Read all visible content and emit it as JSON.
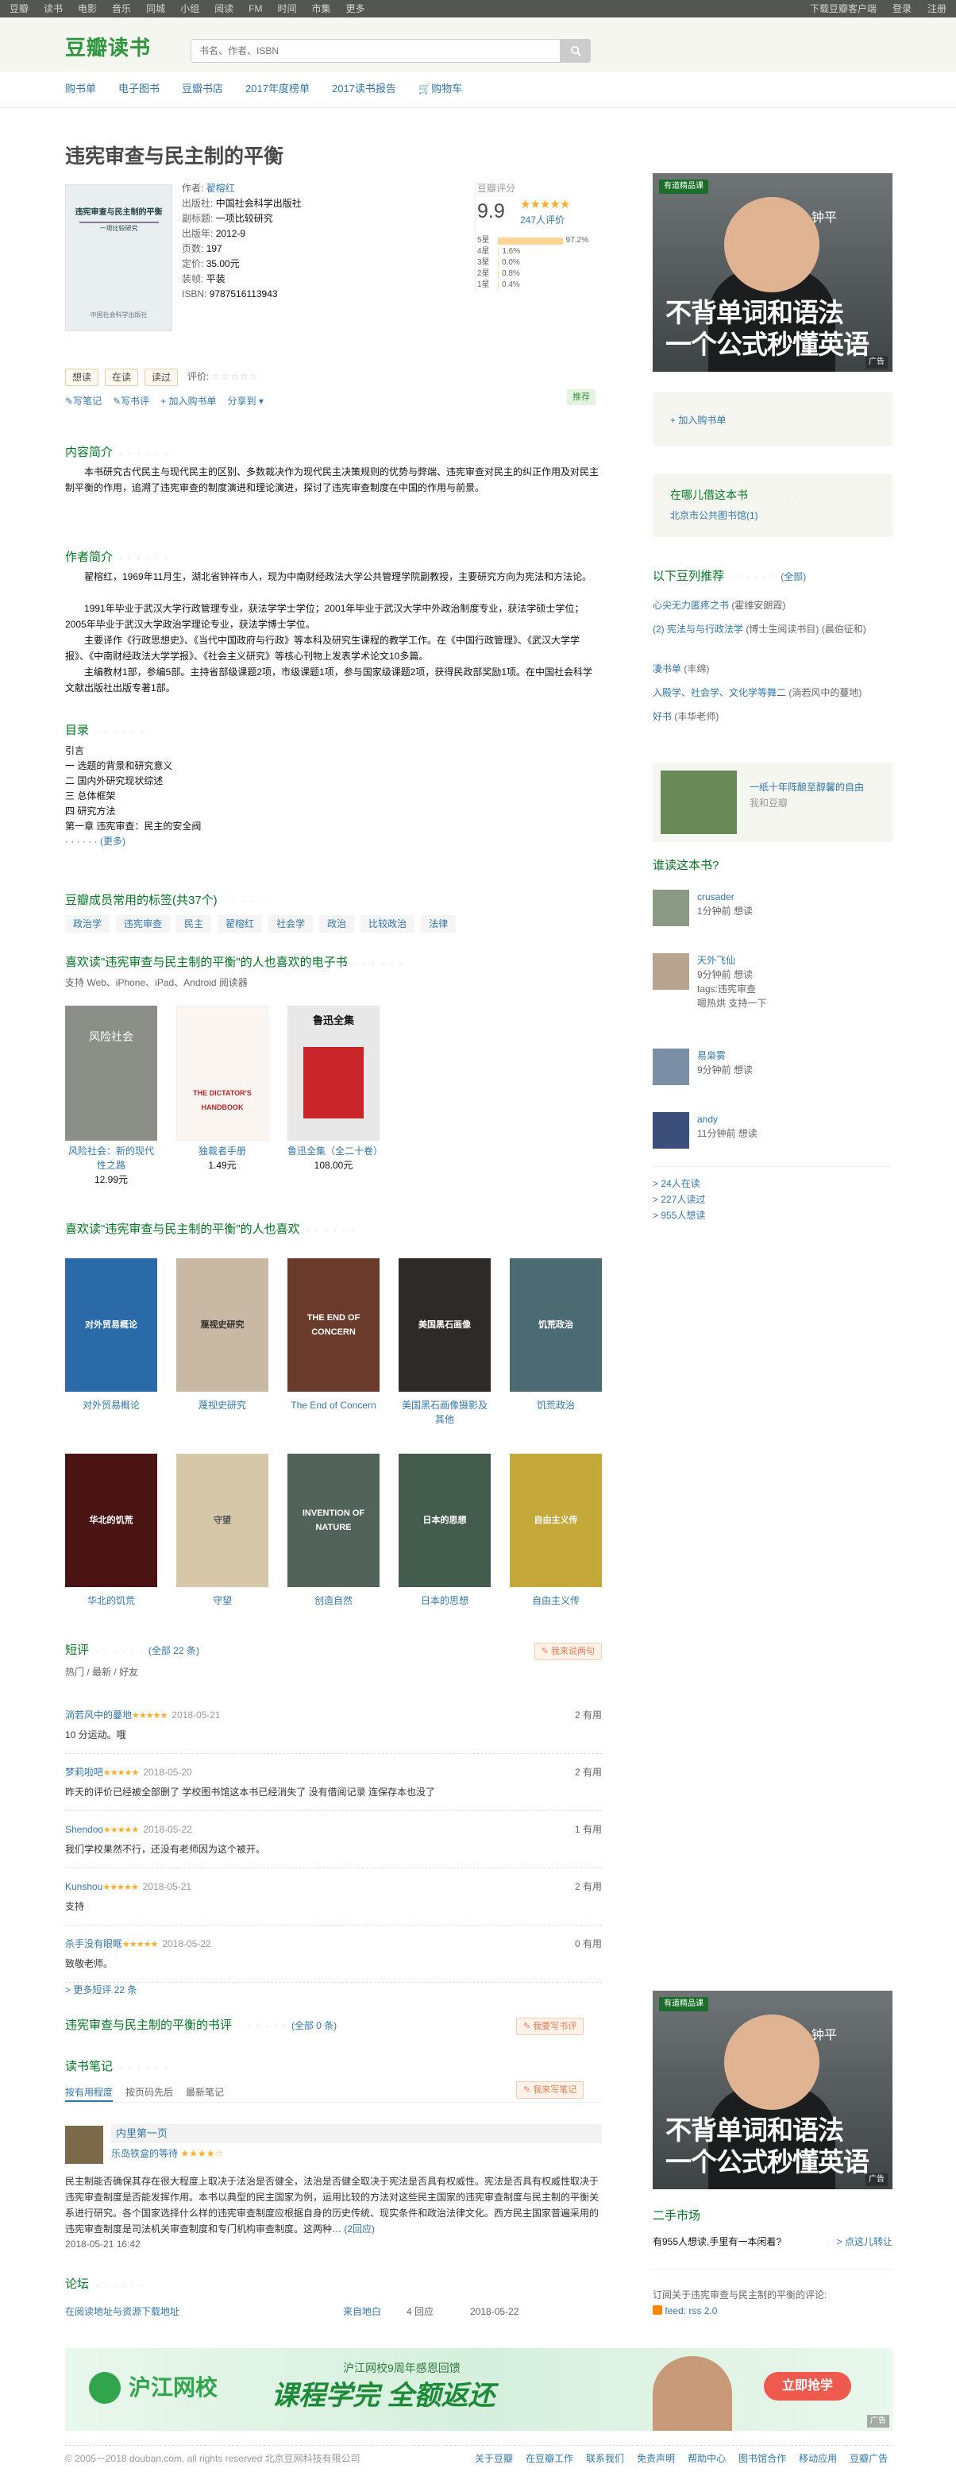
{
  "topbar": {
    "nav": [
      "豆瓣",
      "读书",
      "电影",
      "音乐",
      "同城",
      "小组",
      "阅读",
      "FM",
      "时间",
      "市集",
      "更多"
    ],
    "right": [
      "下载豆瓣客户端",
      "登录",
      "注册"
    ]
  },
  "header": {
    "logo": "豆瓣读书",
    "search_placeholder": "书名、作者、ISBN"
  },
  "subnav": [
    "购书单",
    "电子图书",
    "豆瓣书店",
    "2017年度榜单",
    "2017读书报告",
    "购物车"
  ],
  "book": {
    "title": "违宪审查与民主制的平衡",
    "cover_title": "违宪审查与民主制的平衡",
    "cover_sub": "一项比较研究",
    "cover_pub": "中国社会科学出版社",
    "info": [
      {
        "k": "作者:",
        "v": "翟榕红",
        "link": true
      },
      {
        "k": "出版社:",
        "v": "中国社会科学出版社"
      },
      {
        "k": "副标题:",
        "v": "一项比较研究"
      },
      {
        "k": "出版年:",
        "v": "2012-9"
      },
      {
        "k": "页数:",
        "v": "197"
      },
      {
        "k": "定价:",
        "v": "35.00元"
      },
      {
        "k": "装帧:",
        "v": "平装"
      },
      {
        "k": "ISBN:",
        "v": "9787516113943"
      }
    ]
  },
  "rating": {
    "label": "豆瓣评分",
    "score": "9.9",
    "stars": "★★★★★",
    "count": "247人评价",
    "dist": [
      {
        "s": "5星",
        "p": "97.2%",
        "f": 0.972
      },
      {
        "s": "4星",
        "p": "1.6%",
        "f": 0.016
      },
      {
        "s": "3星",
        "p": "0.0%",
        "f": 0
      },
      {
        "s": "2星",
        "p": "0.8%",
        "f": 0.008
      },
      {
        "s": "1星",
        "p": "0.4%",
        "f": 0.004
      }
    ]
  },
  "actions": {
    "want": "想读",
    "reading": "在读",
    "read": "读过",
    "rate_label": "评价:",
    "rate_stars": "☆☆☆☆☆",
    "links": [
      "写笔记",
      "写书评",
      "加入购书单",
      "分享到"
    ],
    "recommend": "推荐"
  },
  "intro": {
    "title": "内容简介",
    "text": "本书研究古代民主与现代民主的区别、多数裁决作为现代民主决策规则的优势与弊端、违宪审查对民主的纠正作用及对民主制平衡的作用，追溯了违宪审查的制度演进和理论演进，探讨了违宪审查制度在中国的作用与前景。"
  },
  "author": {
    "title": "作者简介",
    "p1": "翟榕红，1969年11月生，湖北省钟祥市人，现为中南财经政法大学公共管理学院副教授，主要研究方向为宪法和方法论。",
    "p2": "1991年毕业于武汉大学行政管理专业，获法学学士学位；2001年毕业于武汉大学中外政治制度专业，获法学硕士学位；2005年毕业于武汉大学政治学理论专业，获法学博士学位。",
    "p3": "主要译作《行政思想史》、《当代中国政府与行政》等本科及研究生课程的教学工作。在《中国行政管理》、《武汉大学学报》、《中南财经政法大学学报》、《社会主义研究》等核心刊物上发表学术论文10多篇。",
    "p4": "主编教材1部，参编5部。主持省部级课题2项，市级课题1项，参与国家级课题2项，获得民政部奖励1项。在中国社会科学文献出版社出版专著1部。"
  },
  "toc": {
    "title": "目录",
    "items": [
      "引言",
      "一 选题的背景和研究意义",
      "二 国内外研究现状综述",
      "三 总体框架",
      "四 研究方法",
      "第一章 违宪审查：民主的安全阀"
    ],
    "more": "· · · · · · (更多)"
  },
  "tags": {
    "title": "豆瓣成员常用的标签(共37个)",
    "items": [
      "政治学",
      "违宪审查",
      "民主",
      "翟榕红",
      "社会学",
      "政治",
      "比较政治",
      "法律"
    ]
  },
  "ebooks": {
    "title": "喜欢读\"违宪审查与民主制的平衡\"的人也喜欢的电子书",
    "support": "支持 Web、iPhone、iPad、Android 阅读器",
    "items": [
      {
        "name": "风险社会：新的现代性之路",
        "price": "12.99元",
        "cover": "风险社会"
      },
      {
        "name": "独裁者手册",
        "price": "1.49元",
        "cover": "THE DICTATOR'S HANDBOOK"
      },
      {
        "name": "鲁迅全集（全二十卷）",
        "price": "108.00元",
        "cover": "鲁迅全集"
      }
    ]
  },
  "alsolike": {
    "title": "喜欢读\"违宪审查与民主制的平衡\"的人也喜欢",
    "row1": [
      {
        "name": "对外贸易概论",
        "cover": "对外贸易概论",
        "c": "#2a6aa8"
      },
      {
        "name": "蔑视史研究",
        "cover": "蔑视史研究",
        "c": "#c9b8a4"
      },
      {
        "name": "The End of Concern",
        "cover": "THE END OF CONCERN",
        "c": "#6a3a2a"
      },
      {
        "name": "美国黑石画像摄影及其他",
        "cover": "美国黑石画像",
        "c": "#2d2a28"
      },
      {
        "name": "饥荒政治",
        "cover": "饥荒政治",
        "c": "#4c6a72"
      }
    ],
    "row2": [
      {
        "name": "华北的饥荒",
        "cover": "华北的饥荒",
        "c": "#4a1412"
      },
      {
        "name": "守望",
        "cover": "守望",
        "c": "#d6c7a8"
      },
      {
        "name": "创造自然",
        "cover": "INVENTION OF NATURE",
        "c": "#52635a"
      },
      {
        "name": "日本的思想",
        "cover": "日本的思想",
        "c": "#445c4e"
      },
      {
        "name": "自由主义传",
        "cover": "自由主义传",
        "c": "#c4a83a"
      }
    ]
  },
  "comments": {
    "title": "短评",
    "count": "(全部 22 条)",
    "write": "我来说两句",
    "sort": "热门 / 最新 / 好友",
    "items": [
      {
        "u": "淌若风中的蔓地",
        "st": "★★★★★",
        "t": "2018-05-21",
        "use": "2 有用",
        "txt": "10 分运动。哦"
      },
      {
        "u": "梦莉啦吧",
        "st": "★★★★★",
        "t": "2018-05-20",
        "use": "2 有用",
        "txt": "昨天的评价已经被全部删了 学校图书馆这本书已经消失了 没有借阅记录 连保存本也没了"
      },
      {
        "u": "Shendoo",
        "st": "★★★★★",
        "t": "2018-05-22",
        "use": "1 有用",
        "txt": "我们学校果然不行，还没有老师因为这个被开。"
      },
      {
        "u": "Kunshou",
        "st": "★★★★★",
        "t": "2018-05-21",
        "use": "2 有用",
        "txt": "支持"
      },
      {
        "u": "杀手没有眼眶",
        "st": "★★★★★",
        "t": "2018-05-22",
        "use": "0 有用",
        "txt": "致敬老师。"
      }
    ],
    "more": "> 更多短评 22 条"
  },
  "reviews": {
    "title": "违宪审查与民主制的平衡的书评",
    "count": "(全部 0 条)",
    "write": "我要写书评"
  },
  "notes": {
    "title": "读书笔记",
    "write": "我来写笔记",
    "tabs": [
      "按有用程度",
      "按页码先后",
      "最新笔记"
    ],
    "note_title": "内里第一页",
    "note_user": "乐岛铁盒的等待",
    "note_stars": "★★★★☆",
    "note_text": "民主制能否确保其存在很大程度上取决于法治是否健全，法治是否健全取决于宪法是否具有权威性。宪法是否具有权威性取决于违宪审查制度是否能发挥作用。本书以典型的民主国家为例，运用比较的方法对这些民主国家的违宪审查制度与民主制的平衡关系进行研究。各个国家选择什么样的违宪审查制度应根据自身的历史传统、现实条件和政治法律文化。西方民主国家普遍采用的违宪审查制度是司法机关审查制度和专门机构审查制度。这两种…",
    "note_more": "(2回应)",
    "note_time": "2018-05-21 16:42"
  },
  "forum": {
    "title": "论坛",
    "topic": "在阅读地址与资源下载地址",
    "from": "来自地白",
    "replies": "4 回应",
    "date": "2018-05-22"
  },
  "sidebar": {
    "ad_tag": "有道精品课",
    "ad_name": "钟平",
    "ad_line1": "不背单词和语法",
    "ad_line2": "一个公式秒懂英语",
    "ad_label": "广告",
    "add_list": "+ 加入购书单",
    "lib_title": "在哪儿借这本书",
    "lib_item": "北京市公共图书馆(1)",
    "dl_title": "以下豆列推荐",
    "dl_more": "(全部)",
    "dl_items": [
      {
        "a": "心尖无力匿疼之书",
        "b": "(霍维安朗霞)"
      },
      {
        "a": "(2) 宪法与与行政法学",
        "b": "(博士生阅读书目)",
        "c": "(晨伯征和)"
      },
      {
        "a": "凄书单",
        "b": "(丰绵)"
      },
      {
        "a": "入殿学、社会学、文化学等舞二",
        "b": "(淌若风中的蔓地)"
      },
      {
        "a": "好书",
        "b": "(丰华老师)"
      }
    ],
    "promo_title": "一纸十年阵酿至醇馨的自由",
    "promo_sub": "我和豆瓣",
    "readers_title": "谁读这本书?",
    "readers": [
      {
        "n": "crusader",
        "t": "1分钟前 想读"
      },
      {
        "n": "天外飞仙",
        "t": "9分钟前 想读",
        "tags": "tags:违宪审查",
        "extra": "嗯热烘 支持一下"
      },
      {
        "n": "易枭雾",
        "t": "9分钟前 想读"
      },
      {
        "n": "andy",
        "t": "11分钟前 想读"
      }
    ],
    "stats": [
      "> 24人在读",
      "> 227人读过",
      "> 955人想读"
    ],
    "market_title": "二手市场",
    "market_text": "有955人想读,手里有一本闲着?",
    "market_link": "> 点这儿转让",
    "rss_text": "订阅关于违宪审查与民主制的平衡的评论:",
    "rss_link": "feed: rss 2.0"
  },
  "bottomad": {
    "brand": "沪江网校",
    "banner": "沪江网校9周年感恩回馈",
    "headline": "课程学完 全额返还",
    "btn": "立即抢学",
    "label": "广告"
  },
  "footer": {
    "copy": "© 2005－2018 douban.com, all rights reserved 北京豆网科技有限公司",
    "links": [
      "关于豆瓣",
      "在豆瓣工作",
      "联系我们",
      "免责声明",
      "帮助中心",
      "图书馆合作",
      "移动应用",
      "豆瓣广告"
    ]
  }
}
